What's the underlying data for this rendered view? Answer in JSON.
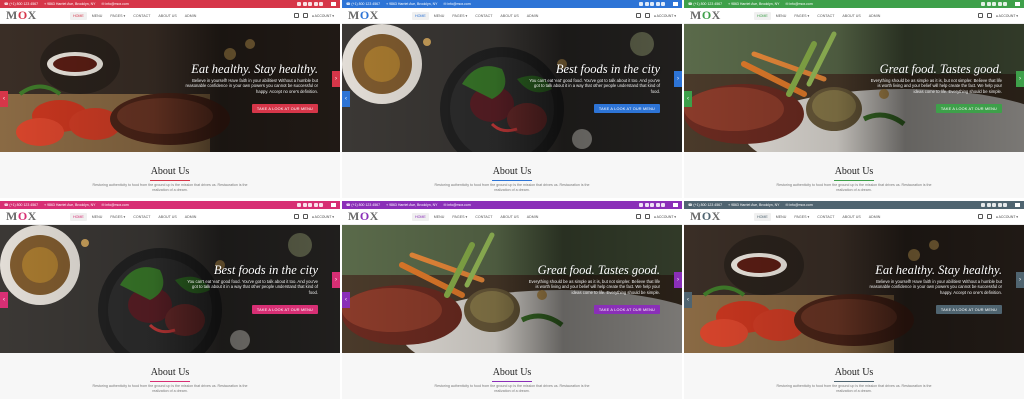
{
  "panels": [
    {
      "theme": "#d63649",
      "hero_title": "Eat healthy. Stay healthy.",
      "hero_text": "Believe in yourself! Have faith in your abilities! Without a humble but reasonable confidence in your own powers you cannot be successful or happy. Accept no one's definition.",
      "scene": "steak"
    },
    {
      "theme": "#2d74d6",
      "hero_title": "Best foods in the city",
      "hero_text": "You can't eat 'eat' good food. You've got to talk about it too. And you've got to talk about it in a way that other people understand that kind of food.",
      "scene": "salad"
    },
    {
      "theme": "#3ea04a",
      "hero_title": "Great food. Tastes good.",
      "hero_text": "Everything should be as simple as it is, but not simpler. Believe that life is worth living and your belief will help create the fact. We help your ideas come to life. Everything should be simple.",
      "scene": "plate"
    },
    {
      "theme": "#d72f74",
      "hero_title": "Best foods in the city",
      "hero_text": "You can't eat 'eat' good food. You've got to talk about it too. And you've got to talk about it in a way that other people understand that kind of food.",
      "scene": "salad"
    },
    {
      "theme": "#8a2fb8",
      "hero_title": "Great food. Tastes good.",
      "hero_text": "Everything should be as simple as it is, but not simpler. Believe that life is worth living and your belief will help create the fact. We help your ideas come to life. Everything should be simple.",
      "scene": "plate"
    },
    {
      "theme": "#4f6470",
      "hero_title": "Eat healthy. Stay healthy.",
      "hero_text": "Believe in yourself! Have faith in your abilities! Without a humble but reasonable confidence in your own powers you cannot be successful or happy. Accept no one's definition.",
      "scene": "steak"
    }
  ],
  "common": {
    "logo_m": "M",
    "logo_o": "O",
    "logo_x": "X",
    "phone": "(+1) 800 123 4567",
    "address": "9863 Harriet Ave, Brooklyn, NY",
    "email": "info@mox.com",
    "nav": [
      "HOME",
      "MENU",
      "PAGES ▾",
      "CONTACT",
      "ABOUT US",
      "ADMIN"
    ],
    "account": "ACCOUNT ▾",
    "button": "TAKE A LOOK AT OUR MENU",
    "about_title": "About Us",
    "about_text": "Restoring authenticity to food from the ground up is the mission that drives us. Restauration is the realization of a dream.",
    "arrow_right": "›",
    "arrow_left": "‹"
  },
  "icons": [
    "phone-icon",
    "pin-icon",
    "mail-icon",
    "facebook-icon",
    "twitter-icon",
    "google-icon",
    "linkedin-icon",
    "instagram-icon",
    "flag-icon",
    "calendar-icon",
    "cart-icon",
    "user-icon"
  ]
}
